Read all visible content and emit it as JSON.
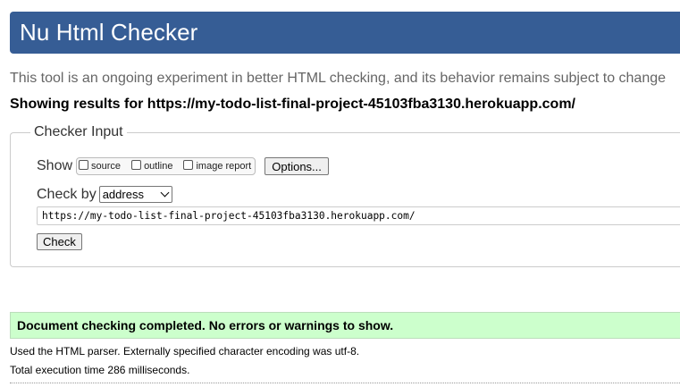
{
  "header": {
    "title": "Nu Html Checker"
  },
  "intro_text": "This tool is an ongoing experiment in better HTML checking, and its behavior remains subject to change",
  "showing_results": "Showing results for https://my-todo-list-final-project-45103fba3130.herokuapp.com/",
  "checker_input": {
    "legend": "Checker Input",
    "show_label": "Show",
    "show_options": [
      {
        "label": "source",
        "checked": false
      },
      {
        "label": "outline",
        "checked": false
      },
      {
        "label": "image report",
        "checked": false
      }
    ],
    "options_button": "Options...",
    "check_by_label": "Check by",
    "check_by_selected": "address",
    "url_value": "https://my-todo-list-final-project-45103fba3130.herokuapp.com/",
    "check_button": "Check"
  },
  "result": {
    "message": "Document checking completed. No errors or warnings to show.",
    "parser_info": "Used the HTML parser. Externally specified character encoding was utf-8.",
    "execution_time": "Total execution time 286 milliseconds."
  },
  "colors": {
    "banner": "#365d95",
    "success_bg": "#ccffcc",
    "intro_text": "#666666"
  },
  "icons": {
    "select_arrow": "chevron-down-icon",
    "checkbox": "checkbox-icon"
  }
}
